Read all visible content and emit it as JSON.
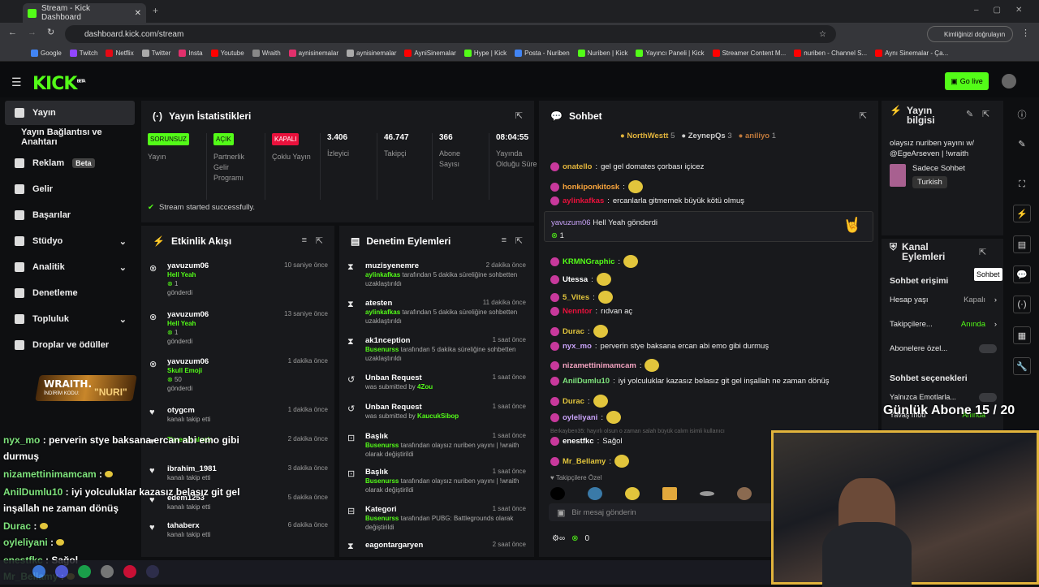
{
  "browser": {
    "tab_title": "Stream - Kick Dashboard",
    "url": "dashboard.kick.com/stream",
    "profile_label": "Kimliğinizi doğrulayın",
    "bookmarks": [
      {
        "label": "Google",
        "color": "#4285f4"
      },
      {
        "label": "Twitch",
        "color": "#9146ff"
      },
      {
        "label": "Netflix",
        "color": "#e50914"
      },
      {
        "label": "Twitter",
        "color": "#aaaaaa"
      },
      {
        "label": "Insta",
        "color": "#e1306c"
      },
      {
        "label": "Youtube",
        "color": "#ff0000"
      },
      {
        "label": "Wraith",
        "color": "#888888"
      },
      {
        "label": "aynisinemalar",
        "color": "#e1306c"
      },
      {
        "label": "aynisinemalar",
        "color": "#aaaaaa"
      },
      {
        "label": "AyniSinemalar",
        "color": "#ff0000"
      },
      {
        "label": "Hype | Kick",
        "color": "#53fc18"
      },
      {
        "label": "Posta - Nuriben",
        "color": "#4285f4"
      },
      {
        "label": "Nuriben | Kick",
        "color": "#53fc18"
      },
      {
        "label": "Yayıncı Paneli | Kick",
        "color": "#53fc18"
      },
      {
        "label": "Streamer Content M...",
        "color": "#ff0000"
      },
      {
        "label": "nuriben - Channel S...",
        "color": "#ff0000"
      },
      {
        "label": "Aynı Sinemalar - Ça...",
        "color": "#ff0000"
      }
    ]
  },
  "header": {
    "logo": "KICK",
    "beta": "BETA",
    "go_live": "Go live"
  },
  "sidebar": [
    {
      "label": "Yayın",
      "active": true
    },
    {
      "label": "Yayın Bağlantısı ve Anahtarı"
    },
    {
      "label": "Reklam",
      "badge": "Beta"
    },
    {
      "label": "Gelir"
    },
    {
      "label": "Başarılar"
    },
    {
      "label": "Stüdyo",
      "chevron": true
    },
    {
      "label": "Analitik",
      "chevron": true
    },
    {
      "label": "Denetleme"
    },
    {
      "label": "Topluluk",
      "chevron": true
    },
    {
      "label": "Droplar ve ödüller"
    }
  ],
  "stats": {
    "title": "Yayın İstatistikleri",
    "items": [
      {
        "pill": "SORUNSUZ",
        "pill_color": "#53fc18",
        "label": "Yayın"
      },
      {
        "pill": "AÇIK",
        "pill_color": "#53fc18",
        "label": "Partnerlik Gelir Programı"
      },
      {
        "pill": "KAPALI",
        "pill_color": "#e9113c",
        "label": "Çoklu Yayın"
      },
      {
        "value": "3.406",
        "label": "İzleyici"
      },
      {
        "value": "46.747",
        "label": "Takipçi"
      },
      {
        "value": "366",
        "label": "Abone Sayısı"
      },
      {
        "value": "08:04:55",
        "label": "Yayında Olduğu Süre"
      }
    ],
    "success": "Stream started successfully."
  },
  "activity": {
    "title": "Etkinlik Akışı",
    "rows": [
      {
        "user": "yavuzum06",
        "time": "10 saniye önce",
        "line1": "Hell Yeah",
        "line2": "1",
        "line3": "gönderdi"
      },
      {
        "user": "yavuzum06",
        "time": "13 saniye önce",
        "line1": "Hell Yeah",
        "line2": "1",
        "line3": "gönderdi"
      },
      {
        "user": "yavuzum06",
        "time": "1 dakika önce",
        "line1": "Skull Emoji",
        "line2": "50",
        "line3": "gönderdi"
      },
      {
        "user": "otygcm",
        "time": "1 dakika önce",
        "line1": "kanalı takip etti"
      },
      {
        "user": "",
        "time": "2 dakika önce",
        "line1": "Timeout alındı"
      },
      {
        "user": "ibrahim_1981",
        "time": "3 dakika önce",
        "line1": "kanalı takip etti"
      },
      {
        "user": "edem1253",
        "time": "5 dakika önce",
        "line1": "kanalı takip etti"
      },
      {
        "user": "tahaberx",
        "time": "6 dakika önce",
        "line1": "kanalı takip etti"
      }
    ]
  },
  "moderation": {
    "title": "Denetim Eylemleri",
    "rows": [
      {
        "title": "muzisyenemre",
        "time": "2 dakika önce",
        "actor": "aylinkafkas",
        "text": "tarafından 5 dakika süreliğine sohbetten uzaklaştırıldı"
      },
      {
        "title": "atesten",
        "time": "11 dakika önce",
        "actor": "aylinkafkas",
        "text": "tarafından 5 dakika süreliğine sohbetten uzaklaştırıldı"
      },
      {
        "title": "ak1nception",
        "time": "1 saat önce",
        "actor": "Busenurss",
        "text": "tarafından 5 dakika süreliğine sohbetten uzaklaştırıldı"
      },
      {
        "title": "Unban Request",
        "time": "1 saat önce",
        "text": "was submitted by",
        "actor2": "4Zou"
      },
      {
        "title": "Unban Request",
        "time": "1 saat önce",
        "text": "was submitted by",
        "actor2": "KaucukSibop"
      },
      {
        "title": "Başlık",
        "time": "1 saat önce",
        "actor": "Busenurss",
        "text": "tarafından olaysız nuriben yayını | !wraith olarak değiştirildi"
      },
      {
        "title": "Başlık",
        "time": "1 saat önce",
        "actor": "Busenurss",
        "text": "tarafından olaysız nuriben yayını | !wraith olarak değiştirildi"
      },
      {
        "title": "Kategori",
        "time": "1 saat önce",
        "actor": "Busenurss",
        "text": "tarafından PUBG: Battlegrounds olarak değiştirildi"
      },
      {
        "title": "eagontargaryen",
        "time": "2 saat önce"
      }
    ]
  },
  "chat": {
    "title": "Sohbet",
    "top": [
      {
        "name": "NorthWestt",
        "n": "5"
      },
      {
        "name": "ZeynepQs",
        "n": "3"
      },
      {
        "name": "aniliyo",
        "n": "1"
      }
    ],
    "messages": [
      {
        "user": "onatello",
        "color": "#e2b43c",
        "text": "gel gel domates çorbası içicez"
      },
      {
        "user": "honkiponkitosk",
        "color": "#f6a33c",
        "text": ""
      },
      {
        "user": "aylinkafkas",
        "color": "#e9113c",
        "text": "ercanlarla gitmemek büyük kötü olmuş"
      },
      {
        "user": "",
        "color": "#fff",
        "text": ""
      },
      {
        "user": "KRMNGraphic",
        "color": "#53fc18",
        "text": ""
      },
      {
        "user": "Utessa",
        "color": "#fff",
        "text": ""
      },
      {
        "user": "5_Vites",
        "color": "#e2c53c",
        "text": ""
      },
      {
        "user": "Nenntor",
        "color": "#e9113c",
        "text": "rıdvan aç"
      },
      {
        "user": "Durac",
        "color": "#e2c53c",
        "text": ""
      },
      {
        "user": "nyx_mo",
        "color": "#c8a2f8",
        "text": "perverin stye baksana ercan abi emo gibi durmuş"
      },
      {
        "user": "nizamettinimamcam",
        "color": "#f3a3c0",
        "text": ""
      },
      {
        "user": "AnilDumlu10",
        "color": "#7ee37c",
        "text": "iyi yolculuklar kazasız belasız git gel inşallah ne zaman dönüş"
      },
      {
        "user": "Durac",
        "color": "#e2c53c",
        "text": ""
      },
      {
        "user": "oyleliyani",
        "color": "#c8a2f8",
        "text": ""
      },
      {
        "user": "enestfkc",
        "color": "#fff",
        "text": "Sağol"
      },
      {
        "user": "Mr_Bellamy",
        "color": "#e2c53c",
        "text": ""
      }
    ],
    "highlight": {
      "user": "yavuzum06",
      "text": "Hell Yeah gönderdi",
      "count": "1"
    },
    "reply": "Berkayben35: hayırlı olsun o zaman salah büyük calım isimli kullanıcı",
    "followers_label": "Takipçilere Özel",
    "placeholder": "Bir mesaj gönderin",
    "count": "0"
  },
  "info": {
    "title": "Yayın bilgisi",
    "stream_title": "olaysız nuriben yayını w/ @EgeArseven | !wraith",
    "category": "Sadece Sohbet",
    "lang": "Turkish"
  },
  "actions": {
    "title": "Kanal Eylemleri",
    "tooltip": "Sohbet",
    "access": "Sohbet erişimi",
    "rows": [
      {
        "label": "Hesap yaşı",
        "value": "Kapalı"
      },
      {
        "label": "Takipçilere...",
        "value": "Anında"
      },
      {
        "label": "Abonelere özel..."
      }
    ],
    "options": "Sohbet seçenekleri",
    "opt_rows": [
      {
        "label": "Yalnızca Emotlarla..."
      },
      {
        "label": "Yavaş mod",
        "value": "Anında"
      }
    ]
  },
  "overlay": {
    "wraith": "WRAITH.",
    "promo": "İNDİRİM KODU:",
    "code": "\"NURI\"",
    "sub_goal": "Günlük Abone 15 / 20",
    "msgs": [
      {
        "user": "nyx_mo",
        "text": "perverin stye baksana ercan abi emo gibi durmuş"
      },
      {
        "user": "nizamettinimamcam",
        "text": ""
      },
      {
        "user": "AnilDumlu10",
        "text": "iyi yolculuklar kazasız belasız git gel inşallah ne zaman dönüş"
      },
      {
        "user": "Durac",
        "text": ""
      },
      {
        "user": "oyleliyani",
        "text": ""
      },
      {
        "user": "enestfkc",
        "text": "Sağol"
      },
      {
        "user": "Mr_Bellamy",
        "text": ""
      }
    ]
  }
}
